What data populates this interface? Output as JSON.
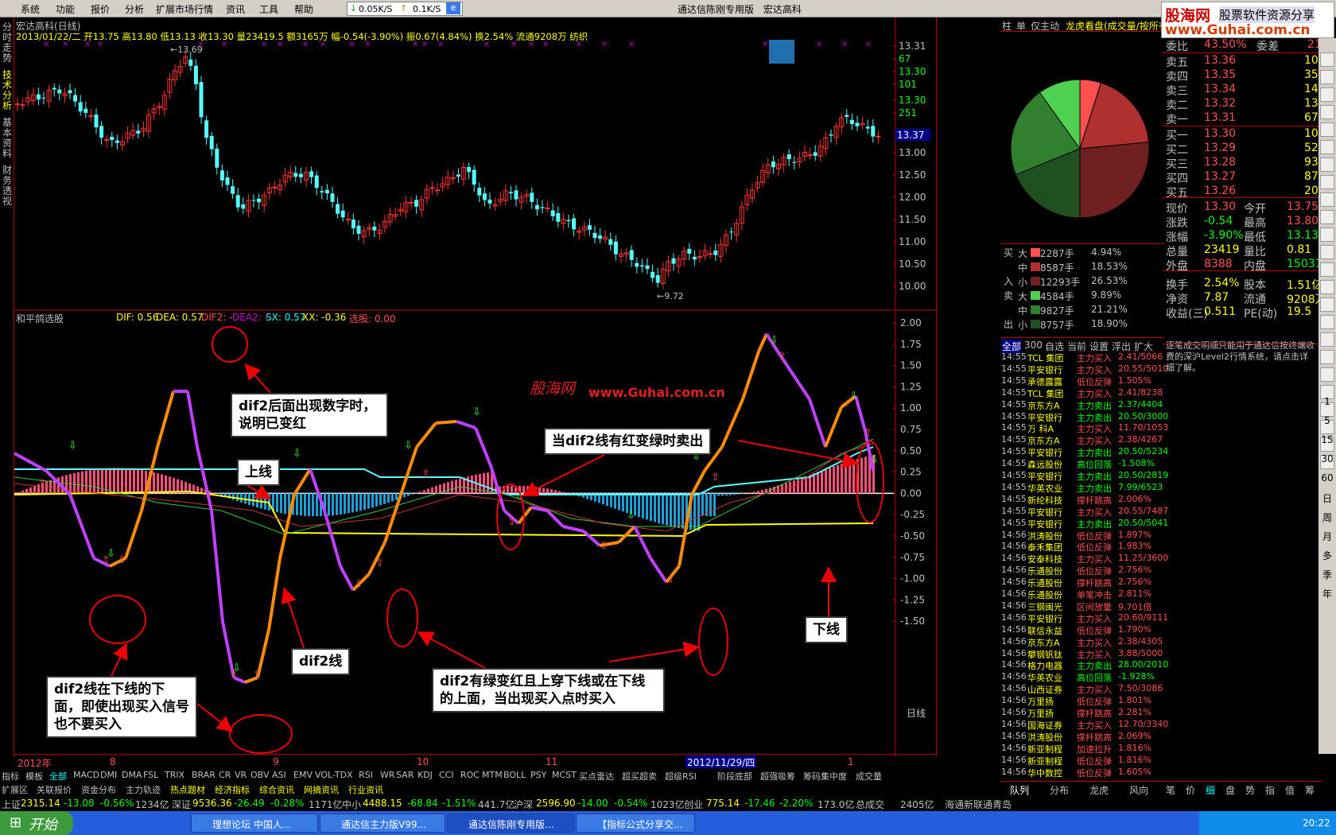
{
  "menu": [
    "系统",
    "功能",
    "报价",
    "分析",
    "扩展市场行情",
    "资讯",
    "工具",
    "帮助"
  ],
  "net": {
    "down": "0.05K/S",
    "up": "0.1K/S"
  },
  "window_title": "通达信陈刚专用版",
  "stock_name": "宏达高科",
  "logo": {
    "top": "股海网",
    "top2": "股票软件资源分享",
    "url": "www.Guhai.com.cn"
  },
  "left_tabs": [
    "分时走势",
    "技术分析",
    "基本资料",
    "财务透视"
  ],
  "kline": {
    "title": "宏达高科(日线)",
    "info": "2013/01/22/二 开13.75 高13.80 低13.13 收13.30 量23419.5 额3165万 幅-0.54(-3.90%) 振0.67(4.84%) 换2.54% 流通9208万 纺织",
    "high_mark": "13.69",
    "low_mark": "9.72",
    "yticks": [
      "13.31",
      "67",
      "13.30",
      "101",
      "13.30",
      "251",
      "13.00",
      "12.50",
      "12.00",
      "11.50",
      "11.00",
      "10.50",
      "10.00"
    ],
    "current_price": "13.37"
  },
  "indicator": {
    "name": "和平鸽选股",
    "dif": "DIF: 0.56",
    "dea": "DEA: 0.57",
    "dif2": "DIF2: -",
    "dea2": "DEA2: -",
    "sx": "SX: 0.57",
    "xx": "XX: -0.36",
    "xuangu": "选股: 0.00",
    "yticks": [
      "2.00",
      "1.75",
      "1.50",
      "1.25",
      "1.00",
      "0.75",
      "0.50",
      "0.25",
      "0.00",
      "-0.25",
      "-0.50",
      "-0.75",
      "-1.00",
      "-1.25",
      "-1.50"
    ]
  },
  "watermark": {
    "cn": "股海网",
    "url": "www.Guhai.com.cn"
  },
  "annotations": {
    "a1": "dif2后面出现数字时，说明已变红",
    "a2": "上线",
    "a3": "dif2线",
    "a4": "dif2线在下线的下面，即使出现买入信号也不要买入",
    "a5": "当dif2线有红变绿时卖出",
    "a6": "dif2有绿变红且上穿下线或在下线的上面，当出现买入点时买入",
    "a7": "下线"
  },
  "xaxis": [
    "2012年",
    "8",
    "9",
    "10",
    "11",
    "2012/11/29/四",
    "1"
  ],
  "right_label": "日线",
  "bottom_tabs": [
    "指标",
    "模板",
    "全部",
    "MACD",
    "DMI",
    "DMA",
    "FSL",
    "TRIX",
    "BRAR",
    "CR",
    "VR",
    "OBV",
    "ASI",
    "EMV",
    "VOL-TDX",
    "RSI",
    "WR",
    "SAR",
    "KDJ",
    "CCI",
    "ROC",
    "MTM",
    "BOLL",
    "PSY",
    "MCST",
    "买点雷达",
    "超买超卖",
    "超级RSI",
    "阶段底部",
    "超强吸筹",
    "筹码集中度",
    "成交量"
  ],
  "sub_tabs": [
    "扩展区",
    "关联报价",
    "资金分布",
    "主力轨迹",
    "热点题材",
    "经济指标",
    "综合资讯",
    "网摘资讯",
    "行业资讯"
  ],
  "pie_tabs": [
    "柱",
    "单",
    "仅主动",
    "龙虎看盘(成交量/按所有"
  ],
  "flow": {
    "buy_label": "买入",
    "sell_label": "卖出",
    "rows": [
      {
        "size": "大",
        "vol": "2287手",
        "pct": "4.94%",
        "color": "#ff5050"
      },
      {
        "size": "中",
        "vol": "8587手",
        "pct": "18.53%",
        "color": "#b03030"
      },
      {
        "size": "小",
        "vol": "12293手",
        "pct": "26.53%",
        "color": "#702020"
      },
      {
        "size": "大",
        "vol": "4584手",
        "pct": "9.89%",
        "color": "#50d050"
      },
      {
        "size": "中",
        "vol": "9827手",
        "pct": "21.21%",
        "color": "#308030"
      },
      {
        "size": "小",
        "vol": "8757手",
        "pct": "18.90%",
        "color": "#205020"
      }
    ]
  },
  "tx_tabs": [
    "全部",
    "300",
    "自选",
    "当前",
    "设置",
    "浮出",
    "扩大"
  ],
  "tx_rows": [
    [
      "14:55",
      "TCL 集团",
      "主力买入",
      "2.41/5066"
    ],
    [
      "14:55",
      "平安银行",
      "主力买入",
      "20.55/5010"
    ],
    [
      "14:55",
      "承德露露",
      "低位反弹",
      "1.505%"
    ],
    [
      "14:55",
      "TCL 集团",
      "主力买入",
      "2.41/8238"
    ],
    [
      "14:55",
      "京东方A",
      "主力卖出",
      "2.37/4404"
    ],
    [
      "14:55",
      "平安银行",
      "主力卖出",
      "20.50/3000"
    ],
    [
      "14:55",
      "万 科A",
      "主力买入",
      "11.70/1053"
    ],
    [
      "14:55",
      "京东方A",
      "主力买入",
      "2.38/4267"
    ],
    [
      "14:55",
      "平安银行",
      "主力卖出",
      "20.50/5234"
    ],
    [
      "14:55",
      "森远股份",
      "高位回落",
      "-1.508%"
    ],
    [
      "14:55",
      "平安银行",
      "主力卖出",
      "20.50/2819"
    ],
    [
      "14:55",
      "华英农业",
      "主力卖出",
      "7.99/6523"
    ],
    [
      "14:55",
      "新纶科技",
      "撑杆跳高",
      "2.006%"
    ],
    [
      "14:55",
      "平安银行",
      "主力买入",
      "20.55/7487"
    ],
    [
      "14:55",
      "平安银行",
      "主力卖出",
      "20.50/5041"
    ],
    [
      "14:56",
      "洪涛股份",
      "低位反弹",
      "1.897%"
    ],
    [
      "14:56",
      "泰禾集团",
      "低位反弹",
      "1.983%"
    ],
    [
      "14:56",
      "安泰科技",
      "主力买入",
      "11.25/3600"
    ],
    [
      "14:56",
      "乐通股份",
      "低位反弹",
      "2.756%"
    ],
    [
      "14:56",
      "乐通股份",
      "撑杆跳高",
      "2.756%"
    ],
    [
      "14:56",
      "乐通股份",
      "单笔冲击",
      "2.811%"
    ],
    [
      "14:56",
      "三钢闽光",
      "区间放量",
      "9.701倍"
    ],
    [
      "14:56",
      "平安银行",
      "主力买入",
      "20.60/9111"
    ],
    [
      "14:56",
      "联信永益",
      "低位反弹",
      "1.790%"
    ],
    [
      "14:56",
      "京东方A",
      "主力买入",
      "2.38/4305"
    ],
    [
      "14:56",
      "攀钢钒钛",
      "主力买入",
      "3.88/5000"
    ],
    [
      "14:56",
      "格力电器",
      "主力卖出",
      "28.00/2010"
    ],
    [
      "14:56",
      "华英农业",
      "高位回落",
      "-1.928%"
    ],
    [
      "14:56",
      "山西证券",
      "主力买入",
      "7.50/3086"
    ],
    [
      "14:56",
      "万里扬",
      "低位反弹",
      "1.801%"
    ],
    [
      "14:56",
      "万里扬",
      "撑杆跳高",
      "2.281%"
    ],
    [
      "14:56",
      "国海证券",
      "主力买入",
      "12.70/3340"
    ],
    [
      "14:56",
      "洪涛股份",
      "撑杆跳高",
      "2.069%"
    ],
    [
      "14:56",
      "新亚制程",
      "加速拉升",
      "1.816%"
    ],
    [
      "14:56",
      "新亚制程",
      "低位反弹",
      "1.816%"
    ],
    [
      "14:56",
      "华中数控",
      "低位反弹",
      "1.605%"
    ]
  ],
  "tx_bottom": [
    "队列",
    "分布",
    "龙虎",
    "风向"
  ],
  "quote": {
    "weibi": "委比",
    "weibi_v": "43.50%",
    "weicha": "委差",
    "weicha_v": "214",
    "sells": [
      [
        "卖五",
        "13.36",
        "10"
      ],
      [
        "卖四",
        "13.35",
        "35"
      ],
      [
        "卖三",
        "13.34",
        "14"
      ],
      [
        "卖二",
        "13.32",
        "13"
      ],
      [
        "卖一",
        "13.31",
        "67"
      ]
    ],
    "buys": [
      [
        "买一",
        "13.30",
        "101"
      ],
      [
        "买二",
        "13.29",
        "52"
      ],
      [
        "买三",
        "13.28",
        "93"
      ],
      [
        "买四",
        "13.27",
        "87"
      ],
      [
        "买五",
        "13.26",
        "20"
      ]
    ],
    "stats": [
      [
        "现价",
        "13.30",
        "今开",
        "13.75"
      ],
      [
        "涨跌",
        "-0.54",
        "最高",
        "13.80"
      ],
      [
        "涨幅",
        "-3.90%",
        "最低",
        "13.13"
      ],
      [
        "总量",
        "23419",
        "量比",
        "0.81"
      ],
      [
        "外盘",
        "8388",
        "内盘",
        "15031"
      ],
      [
        "换手",
        "2.54%",
        "股本",
        "1.51亿"
      ],
      [
        "净资",
        "7.87",
        "流通",
        "9208万"
      ],
      [
        "收益(三)",
        "0.511",
        "PE(动)",
        "19.5"
      ]
    ],
    "note": "逐笔成交明细只能用于通达信按终端收费的深沪Level2行情系统，请点击详细了解。",
    "bottom_tabs": [
      "笔",
      "价",
      "细",
      "盘",
      "势",
      "指",
      "值",
      "筹"
    ]
  },
  "right_icons": [
    "1",
    "5",
    "15",
    "30",
    "60",
    "日",
    "周",
    "月",
    "多",
    "季",
    "年"
  ],
  "status": {
    "sh": "上证",
    "sh_v": "2315.14",
    "sh_c": "-13.08",
    "sh_p": "-0.56%",
    "sh_a": "1234亿",
    "sz": "深证",
    "sz_v": "9536.36",
    "sz_c": "-26.49",
    "sz_p": "-0.28%",
    "sz_a": "1171亿",
    "zx": "中小",
    "zx_v": "4488.15",
    "zx_c": "-68.84",
    "zx_p": "-1.51%",
    "zx_a": "441.7亿",
    "hs": "沪深",
    "hs_v": "2596.90",
    "hs_c": "-14.00",
    "hs_p": "-0.54%",
    "hs_a": "1023亿",
    "cy": "创业",
    "cy_v": "775.14",
    "cy_c": "-17.46",
    "cy_p": "-2.20%",
    "cy_a": "173.0亿",
    "total": "总成交",
    "total_v": "2405亿",
    "broker": "海通新联通青岛"
  },
  "taskbar": {
    "start": "开始",
    "tasks": [
      "理想论坛 中国人...",
      "通达信主力版V99...",
      "通达信陈刚专用版...",
      "【指标公式分享交..."
    ],
    "time": "20:22"
  }
}
